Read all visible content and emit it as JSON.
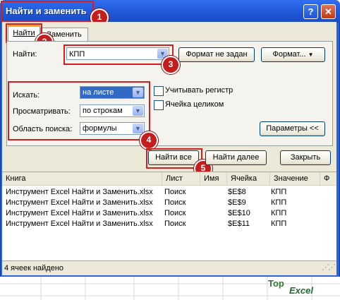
{
  "window": {
    "title": "Найти и заменить"
  },
  "tabs": [
    {
      "label": "Найти"
    },
    {
      "label": "Заменить"
    }
  ],
  "find": {
    "label": "Найти:",
    "value": "КПП",
    "format_status": "Формат не задан",
    "format_button": "Формат..."
  },
  "options": {
    "within_label": "Искать:",
    "within_value": "на листе",
    "search_label": "Просматривать:",
    "search_value": "по строкам",
    "lookin_label": "Область поиска:",
    "lookin_value": "формулы",
    "match_case": "Учитывать регистр",
    "entire_cell": "Ячейка целиком",
    "params_button": "Параметры <<"
  },
  "actions": {
    "find_all": "Найти все",
    "find_next": "Найти далее",
    "close": "Закрыть"
  },
  "results": {
    "columns": [
      "Книга",
      "Лист",
      "Имя",
      "Ячейка",
      "Значение",
      "Ф"
    ],
    "rows": [
      [
        "Инструмент Excel Найти и Заменить.xlsx",
        "Поиск",
        "",
        "$E$8",
        "КПП"
      ],
      [
        "Инструмент Excel Найти и Заменить.xlsx",
        "Поиск",
        "",
        "$E$9",
        "КПП"
      ],
      [
        "Инструмент Excel Найти и Заменить.xlsx",
        "Поиск",
        "",
        "$E$10",
        "КПП"
      ],
      [
        "Инструмент Excel Найти и Заменить.xlsx",
        "Поиск",
        "",
        "$E$11",
        "КПП"
      ]
    ]
  },
  "status": "4 ячеек найдено",
  "badges": [
    "1",
    "2",
    "3",
    "4",
    "5"
  ],
  "logo": {
    "top": "Top",
    "excel": "Excel"
  },
  "colors": {
    "title_bar": "#2063dc",
    "highlight_red": "#d21f1f",
    "selection_blue": "#316ac5"
  }
}
